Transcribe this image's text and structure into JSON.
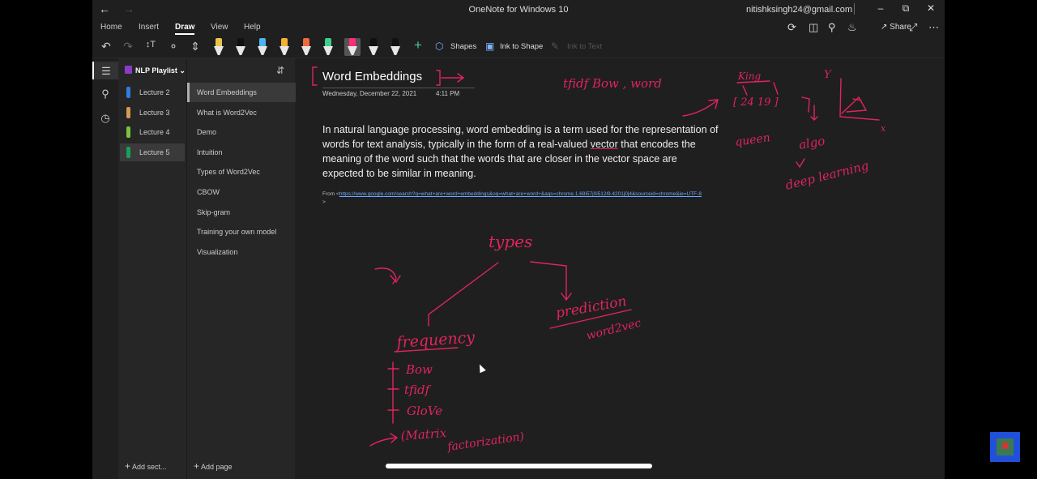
{
  "window": {
    "title": "OneNote for Windows 10",
    "user": "nitishksingh24@gmail.com",
    "back_icon": "arrow-left-icon",
    "minimize": "–",
    "maximize": "⧉",
    "close": "✕"
  },
  "ribbon": {
    "tabs": [
      {
        "label": "Home"
      },
      {
        "label": "Insert"
      },
      {
        "label": "Draw",
        "active": true
      },
      {
        "label": "View"
      },
      {
        "label": "Help"
      }
    ],
    "share_label": "Share"
  },
  "toolbar": {
    "shapes_label": "Shapes",
    "ink_to_shape_label": "Ink to Shape",
    "ink_to_text_label": "Ink to Text",
    "pens": [
      {
        "color": "#e9c64a"
      },
      {
        "color": "#111111"
      },
      {
        "color": "#4ab5f0"
      },
      {
        "color": "#f2b233"
      },
      {
        "color": "#f06a3c"
      },
      {
        "color": "#3ecf8e"
      },
      {
        "color": "#ff2b7a",
        "selected": true
      },
      {
        "color": "#111111"
      },
      {
        "color": "#111111"
      }
    ]
  },
  "notebook": {
    "name": "NLP Playlist",
    "sections": [
      {
        "label": "Lecture 2",
        "color": "#2f7de1"
      },
      {
        "label": "Lecture 3",
        "color": "#d49a54"
      },
      {
        "label": "Lecture 4",
        "color": "#7cc23e"
      },
      {
        "label": "Lecture 5",
        "color": "#18a05a",
        "active": true
      }
    ],
    "add_section_label": "Add sect...",
    "pages": [
      {
        "label": "Word Embeddings",
        "active": true
      },
      {
        "label": "What is Word2Vec"
      },
      {
        "label": "Demo"
      },
      {
        "label": "Intuition"
      },
      {
        "label": "Types of Word2Vec"
      },
      {
        "label": "CBOW"
      },
      {
        "label": "Skip-gram"
      },
      {
        "label": "Training your own model"
      },
      {
        "label": "Visualization"
      }
    ],
    "add_page_label": "Add page"
  },
  "page": {
    "title": "Word Embeddings",
    "date": "Wednesday, December 22, 2021",
    "time": "4:11 PM",
    "paragraph_before": "In natural language processing, word embedding is a term used for the representation of words for text analysis, typically in the form of a real-valued ",
    "paragraph_underlined": "vector",
    "paragraph_after": " that encodes the meaning of the word such that the words that are closer in the vector space are expected to be similar in meaning.",
    "source_prefix": "From <",
    "source_url": "https://www.google.com/search?q=what+are+word+embeddings&oq=what+are+word+&aqs=chrome.1.69i57j0i512l9.4201j0j4&sourceid=chrome&ie=UTF-8",
    "source_suffix": ">"
  },
  "ink_notes": {
    "top": "tfidf  Bow , word",
    "king": "King",
    "vector": "[ 24  19 ]",
    "queen": "queen",
    "algo": "algo",
    "deep": "deep learning",
    "axis_y": "Y",
    "axis_x": "x",
    "types": "types",
    "frequency": "frequency",
    "prediction": "prediction",
    "word2vec": "word2vec",
    "bow": "Bow",
    "tfidf": "tfidf",
    "glove": "GloVe",
    "matrix": "(Matrix",
    "factor": "factorization)"
  }
}
